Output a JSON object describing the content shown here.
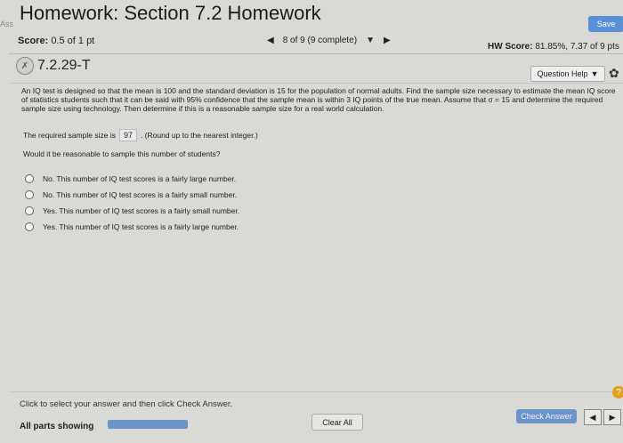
{
  "header": {
    "title": "Homework: Section 7.2 Homework",
    "side_label": "Ass",
    "save_label": "Save"
  },
  "score": {
    "label": "Score:",
    "value": "0.5 of 1 pt"
  },
  "navigation": {
    "prev_icon": "◀",
    "position": "8 of 9 (9 complete)",
    "dropdown_icon": "▼",
    "next_icon": "▶"
  },
  "hw_score": {
    "label": "HW Score:",
    "value": "81.85%, 7.37 of 9 pts"
  },
  "question": {
    "id": "7.2.29-T",
    "status_icon": "partial-credit-icon",
    "help_label": "Question Help",
    "help_dropdown": "▼",
    "gear_icon": "✿"
  },
  "problem_text": "An IQ test is designed so that the mean is 100 and the standard deviation is 15 for the population of normal adults. Find the sample size necessary to estimate the mean IQ score of statistics students such that it can be said with 95% confidence that the sample mean is within 3 IQ points of the true mean. Assume that σ = 15 and determine the required sample size using technology. Then determine if this is a reasonable sample size for a real world calculation.",
  "required": {
    "prefix": "The required sample size is",
    "answer": "97",
    "suffix": ". (Round up to the nearest integer.)"
  },
  "second_question": "Would it be reasonable to sample this number of students?",
  "options": [
    "No. This number of IQ test scores is a fairly large number.",
    "No. This number of IQ test scores is a fairly small number.",
    "Yes. This number of IQ test scores is a fairly small number.",
    "Yes. This number of IQ test scores is a fairly large number."
  ],
  "footer": {
    "instruction": "Click to select your answer and then click Check Answer.",
    "parts_label": "All parts showing",
    "clear_label": "Clear All",
    "check_label": "Check Answer",
    "prev_icon": "◀",
    "next_icon": "▶",
    "help_icon": "?"
  },
  "colors": {
    "accent": "#5b8fd6",
    "progress": "#6a94c8",
    "hint": "#e0a020"
  }
}
